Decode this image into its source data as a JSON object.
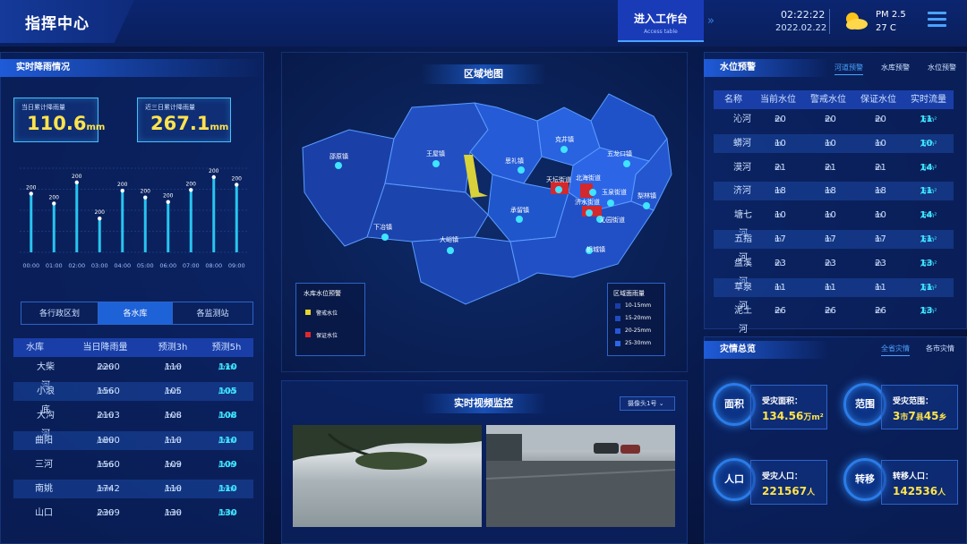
{
  "header": {
    "logo": "指挥中心",
    "work_btn": "进入工作台",
    "work_btn_sub": "Access table",
    "time": "02:22:22",
    "date": "2022.02.22",
    "pm": "PM 2.5",
    "temp": "27 C",
    "weather_icon": "sun-cloud-icon",
    "menu_icon": "hamburger-menu-icon"
  },
  "rain": {
    "title": "实时降雨情况",
    "today_label": "当日累计降雨量",
    "today_value": "110.6",
    "today_unit": "mm",
    "three_label": "近三日累计降雨量",
    "three_value": "267.1",
    "three_unit": "mm"
  },
  "chart_data": {
    "type": "bar",
    "categories": [
      "00:00",
      "01:00",
      "02:00",
      "03:00",
      "04:00",
      "05:00",
      "06:00",
      "07:00",
      "08:00",
      "09:00"
    ],
    "values": [
      200,
      200,
      200,
      200,
      200,
      200,
      200,
      200,
      200,
      200
    ],
    "title": "",
    "xlabel": "",
    "ylabel": ""
  },
  "tabs": [
    "各行政区划",
    "各水库",
    "各监测站"
  ],
  "reservoir": {
    "headers": [
      "水库",
      "当日降雨量",
      "预测3h",
      "预测5h"
    ],
    "rows": [
      {
        "name": "大柴河",
        "today": "2200",
        "h3": "110",
        "h5": "110"
      },
      {
        "name": "小浪底",
        "today": "1560",
        "h3": "105",
        "h5": "105"
      },
      {
        "name": "大沟河",
        "today": "2103",
        "h3": "108",
        "h5": "108"
      },
      {
        "name": "曲阳",
        "today": "1800",
        "h3": "110",
        "h5": "110"
      },
      {
        "name": "三河",
        "today": "1560",
        "h3": "109",
        "h5": "109"
      },
      {
        "name": "南姚",
        "today": "1742",
        "h3": "110",
        "h5": "110"
      },
      {
        "name": "山口",
        "today": "2309",
        "h3": "130",
        "h5": "130"
      }
    ],
    "unit": "/mm"
  },
  "map": {
    "title": "区域地图",
    "places": [
      "邵原镇",
      "王屋镇",
      "思礼镇",
      "克井镇",
      "五龙口镇",
      "天坛街道",
      "北海街道",
      "玉泉街道",
      "梨林镇",
      "济水街道",
      "沁园街道",
      "承留镇",
      "下冶镇",
      "大峪镇",
      "轵城镇"
    ],
    "legend1_title": "水库水位预警",
    "legend1_items": [
      "警戒水位",
      "保证水位"
    ],
    "legend2_title": "区域面雨量",
    "legend2_items": [
      "10-15mm",
      "15-20mm",
      "20-25mm",
      "25-30mm"
    ],
    "colors": {
      "warn": "#e6d62a",
      "guarantee": "#e0282c"
    }
  },
  "video": {
    "title": "实时视频监控",
    "camera": "摄像头1号"
  },
  "water": {
    "title": "水位预警",
    "tabs": [
      "河道预警",
      "水库预警",
      "水位预警"
    ],
    "headers": [
      "名称",
      "当前水位",
      "警戒水位",
      "保证水位",
      "实时流量"
    ],
    "rows": [
      {
        "name": "沁河",
        "cur": "20",
        "warn": "20",
        "guar": "20",
        "flow": "11"
      },
      {
        "name": "蟒河",
        "cur": "10",
        "warn": "10",
        "guar": "10",
        "flow": "10"
      },
      {
        "name": "漠河",
        "cur": "21",
        "warn": "21",
        "guar": "21",
        "flow": "14"
      },
      {
        "name": "济河",
        "cur": "18",
        "warn": "18",
        "guar": "18",
        "flow": "11"
      },
      {
        "name": "塘七河",
        "cur": "10",
        "warn": "10",
        "guar": "10",
        "flow": "14"
      },
      {
        "name": "五指河",
        "cur": "17",
        "warn": "17",
        "guar": "17",
        "flow": "11"
      },
      {
        "name": "盘溪河",
        "cur": "23",
        "warn": "23",
        "guar": "23",
        "flow": "13"
      },
      {
        "name": "草泉河",
        "cur": "11",
        "warn": "11",
        "guar": "11",
        "flow": "11"
      },
      {
        "name": "泥土河",
        "cur": "26",
        "warn": "26",
        "guar": "26",
        "flow": "13"
      }
    ],
    "m_unit": "m",
    "flow_unit": "万m²"
  },
  "disaster": {
    "title": "灾情总览",
    "tabs": [
      "全省灾情",
      "各市灾情"
    ],
    "area_ring": "面积",
    "area_label": "受灾面积：",
    "area_value": "134.56",
    "area_unit": "万m²",
    "range_ring": "范围",
    "range_label": "受灾范围：",
    "range_a": "3",
    "range_a_unit": "市",
    "range_b": "7",
    "range_b_unit": "县",
    "range_c": "45",
    "range_c_unit": "乡",
    "pop_ring": "人口",
    "pop_label": "受灾人口：",
    "pop_value": "221567",
    "pop_unit": "人",
    "move_ring": "转移",
    "move_label": "转移人口：",
    "move_value": "142536",
    "move_unit": "人"
  }
}
